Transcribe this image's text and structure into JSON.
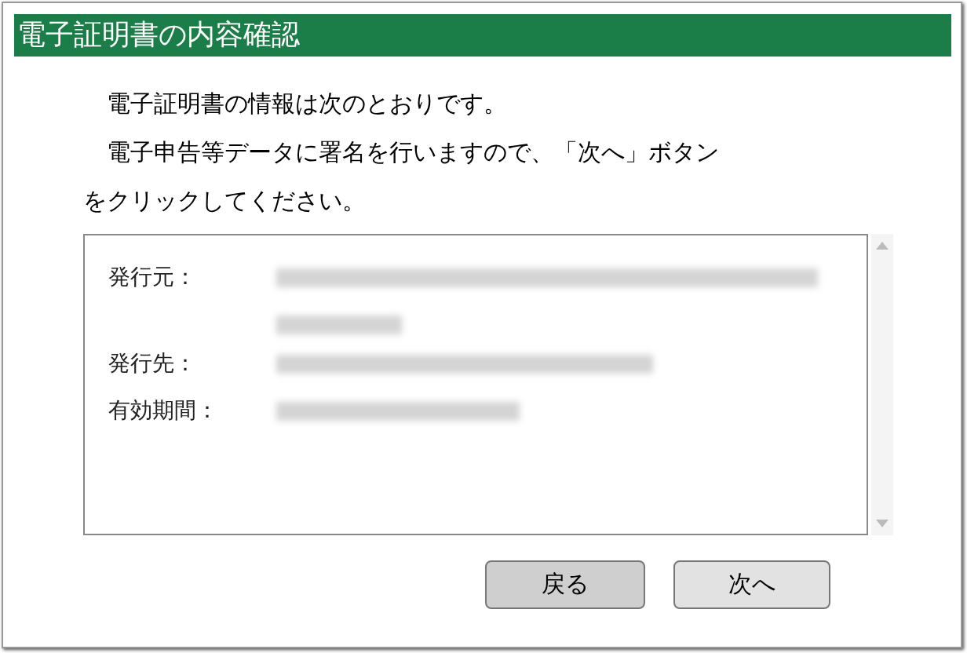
{
  "window": {
    "title": "電子証明書の内容確認"
  },
  "message": [
    "電子証明書の情報は次のとおりです。",
    "電子申告等データに署名を行いますので、「次へ」ボタン",
    "をクリックしてください。"
  ],
  "fields": [
    {
      "label": "発行元："
    },
    {
      "label": "発行先："
    },
    {
      "label": "有効期間："
    }
  ],
  "buttons": [
    {
      "label": "戻る",
      "kind": "back"
    },
    {
      "label": "次へ",
      "kind": "next"
    }
  ]
}
